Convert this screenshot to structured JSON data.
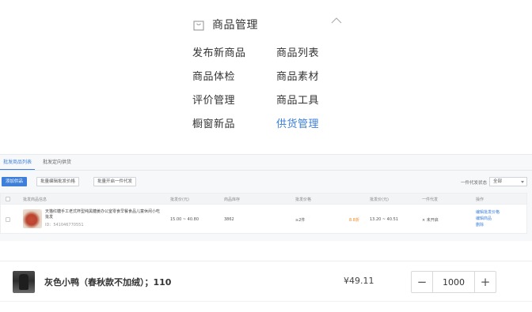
{
  "menu": {
    "title": "商品管理",
    "icon": "shopping-bag-icon",
    "items": [
      {
        "label": "发布新商品"
      },
      {
        "label": "商品列表"
      },
      {
        "label": "商品体检"
      },
      {
        "label": "商品素材"
      },
      {
        "label": "评价管理"
      },
      {
        "label": "商品工具"
      },
      {
        "label": "橱窗新品"
      },
      {
        "label": "供货管理",
        "active": true
      }
    ],
    "active_color": "#3d7fd9"
  },
  "admin": {
    "tabs": [
      {
        "label": "批发商品列表",
        "active": true
      },
      {
        "label": "批发定向供货"
      }
    ],
    "toolbar": {
      "add_button": "添加供品",
      "btn_2": "批量编辑批发价格",
      "btn_3": "批量开启一件代发",
      "filter_label": "一件代发状态",
      "filter_value": "全部"
    },
    "table": {
      "headers": [
        "批发商品信息",
        "批发价(元)",
        "商品库存",
        "批发价格",
        "批发价(元)",
        "一件代发",
        "操作"
      ],
      "row": {
        "title": "天猫红糖手工老式杯型纯黑糖姜办公室零食早餐食品儿童休闲小吃批发",
        "sku": "ID：541046770551",
        "price_range": "15.00 ~ 40.80",
        "stock": "3862",
        "tier": "≥2件",
        "tier_discount": "8.8折",
        "price_range_2": "13.20 ~ 40.51",
        "dropship": "× 未开启",
        "actions": [
          "编辑批发价格",
          "编辑商品",
          "删除"
        ]
      }
    }
  },
  "product": {
    "name": "灰色小鸭（春秋款不加绒）；110",
    "price": "¥49.11",
    "quantity": "1000",
    "minus": "−",
    "plus": "+"
  }
}
